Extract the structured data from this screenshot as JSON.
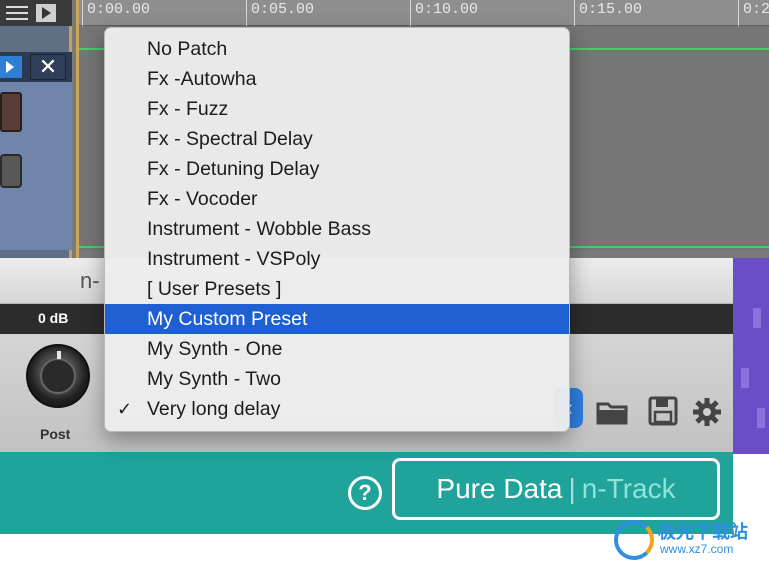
{
  "timeline": {
    "ticks": [
      "0:00.00",
      "0:05.00",
      "0:10.00",
      "0:15.00",
      "0:2"
    ]
  },
  "plugin": {
    "title": "n-",
    "gain_label": "0 dB",
    "knob_label": "Post"
  },
  "footer": {
    "help": "?",
    "brand_left": "Pure Data",
    "brand_sep": "|",
    "brand_right": "n-Track"
  },
  "menu": {
    "items": [
      {
        "label": "No Patch"
      },
      {
        "label": "Fx -Autowha"
      },
      {
        "label": "Fx - Fuzz"
      },
      {
        "label": "Fx - Spectral Delay"
      },
      {
        "label": "Fx - Detuning Delay"
      },
      {
        "label": "Fx - Vocoder"
      },
      {
        "label": "Instrument - Wobble Bass"
      },
      {
        "label": "Instrument - VSPoly"
      },
      {
        "label": "[ User Presets ]"
      },
      {
        "label": "My Custom Preset"
      },
      {
        "label": "My Synth - One"
      },
      {
        "label": "My Synth - Two"
      },
      {
        "label": "Very long delay"
      }
    ],
    "highlighted_index": 9,
    "checked_index": 12,
    "check_glyph": "✓"
  },
  "watermark": {
    "line1": "极光下载站",
    "line2": "www.xz7.com"
  },
  "colors": {
    "highlight": "#1e60d2",
    "footer": "#1fa39a",
    "accent_green": "#3ed26a"
  },
  "icons": {
    "folder": "folder-icon",
    "save": "save-icon",
    "settings": "gear-icon"
  }
}
